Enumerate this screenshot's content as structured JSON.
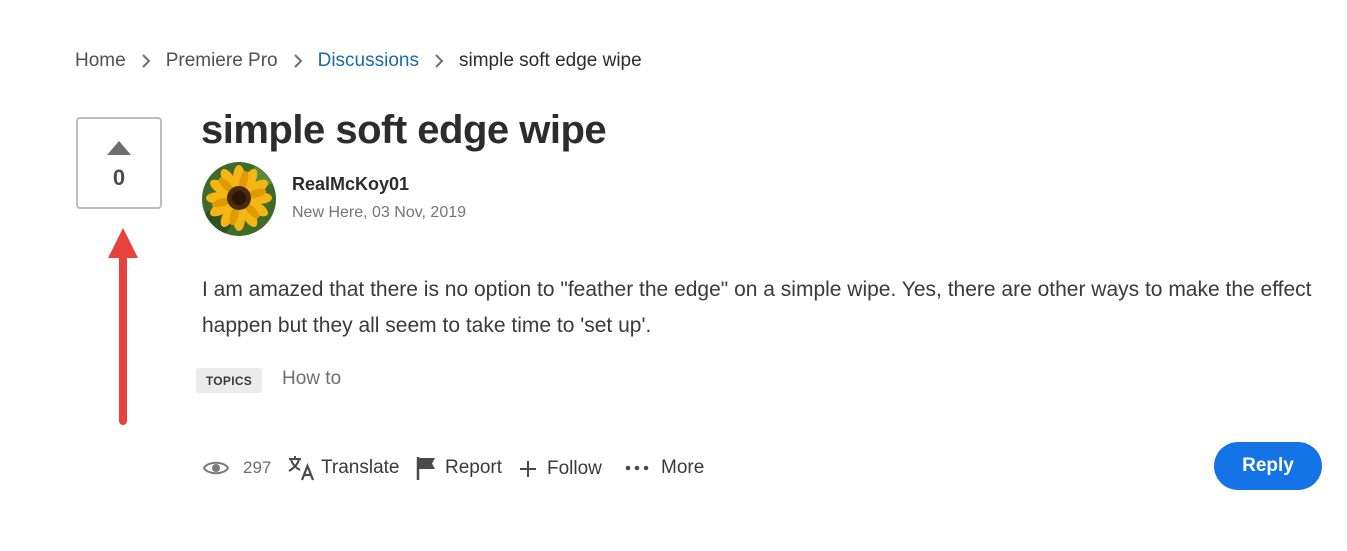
{
  "breadcrumb": {
    "items": [
      {
        "label": "Home"
      },
      {
        "label": "Premiere Pro"
      },
      {
        "label": "Discussions"
      },
      {
        "label": "simple soft edge wipe"
      }
    ]
  },
  "vote": {
    "count": "0"
  },
  "post": {
    "title": "simple soft edge wipe",
    "author": "RealMcKoy01",
    "meta": "New Here, 03 Nov, 2019",
    "body": "I am amazed that there is no option to \"feather the edge\" on a simple wipe.  Yes, there are other ways to make the effect happen but they all seem to take time to 'set up'.",
    "topics_label": "TOPICS",
    "topic": "How to"
  },
  "actions": {
    "views": "297",
    "translate": "Translate",
    "report": "Report",
    "follow": "Follow",
    "more": "More",
    "reply": "Reply"
  },
  "icons": {
    "views": "eye-icon",
    "translate": "translate-icon",
    "report": "flag-icon",
    "follow": "plus-icon",
    "more": "ellipsis-icon",
    "annotation": "red-arrow"
  },
  "colors": {
    "accent": "#1473e6",
    "link": "#1a6aa8",
    "annotation": "#e8423e"
  }
}
